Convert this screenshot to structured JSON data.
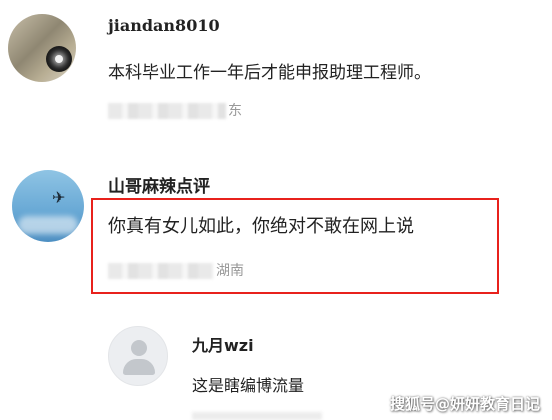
{
  "comments": [
    {
      "username": "jiandan8010",
      "content": "本科毕业工作一年后才能申报助理工程师。",
      "location_visible": "东"
    },
    {
      "username": "山哥麻辣点评",
      "content": "你真有女儿如此，你绝对不敢在网上说",
      "location_visible": "湖南",
      "highlighted": true,
      "highlight_color": "#e8211c"
    }
  ],
  "reply": {
    "username": "九月wzi",
    "content": "这是瞎编博流量"
  },
  "watermark": "搜狐号@妍妍教育日记",
  "icons": {
    "default_avatar": "default-user-avatar-icon",
    "plane": "airplane-icon"
  }
}
